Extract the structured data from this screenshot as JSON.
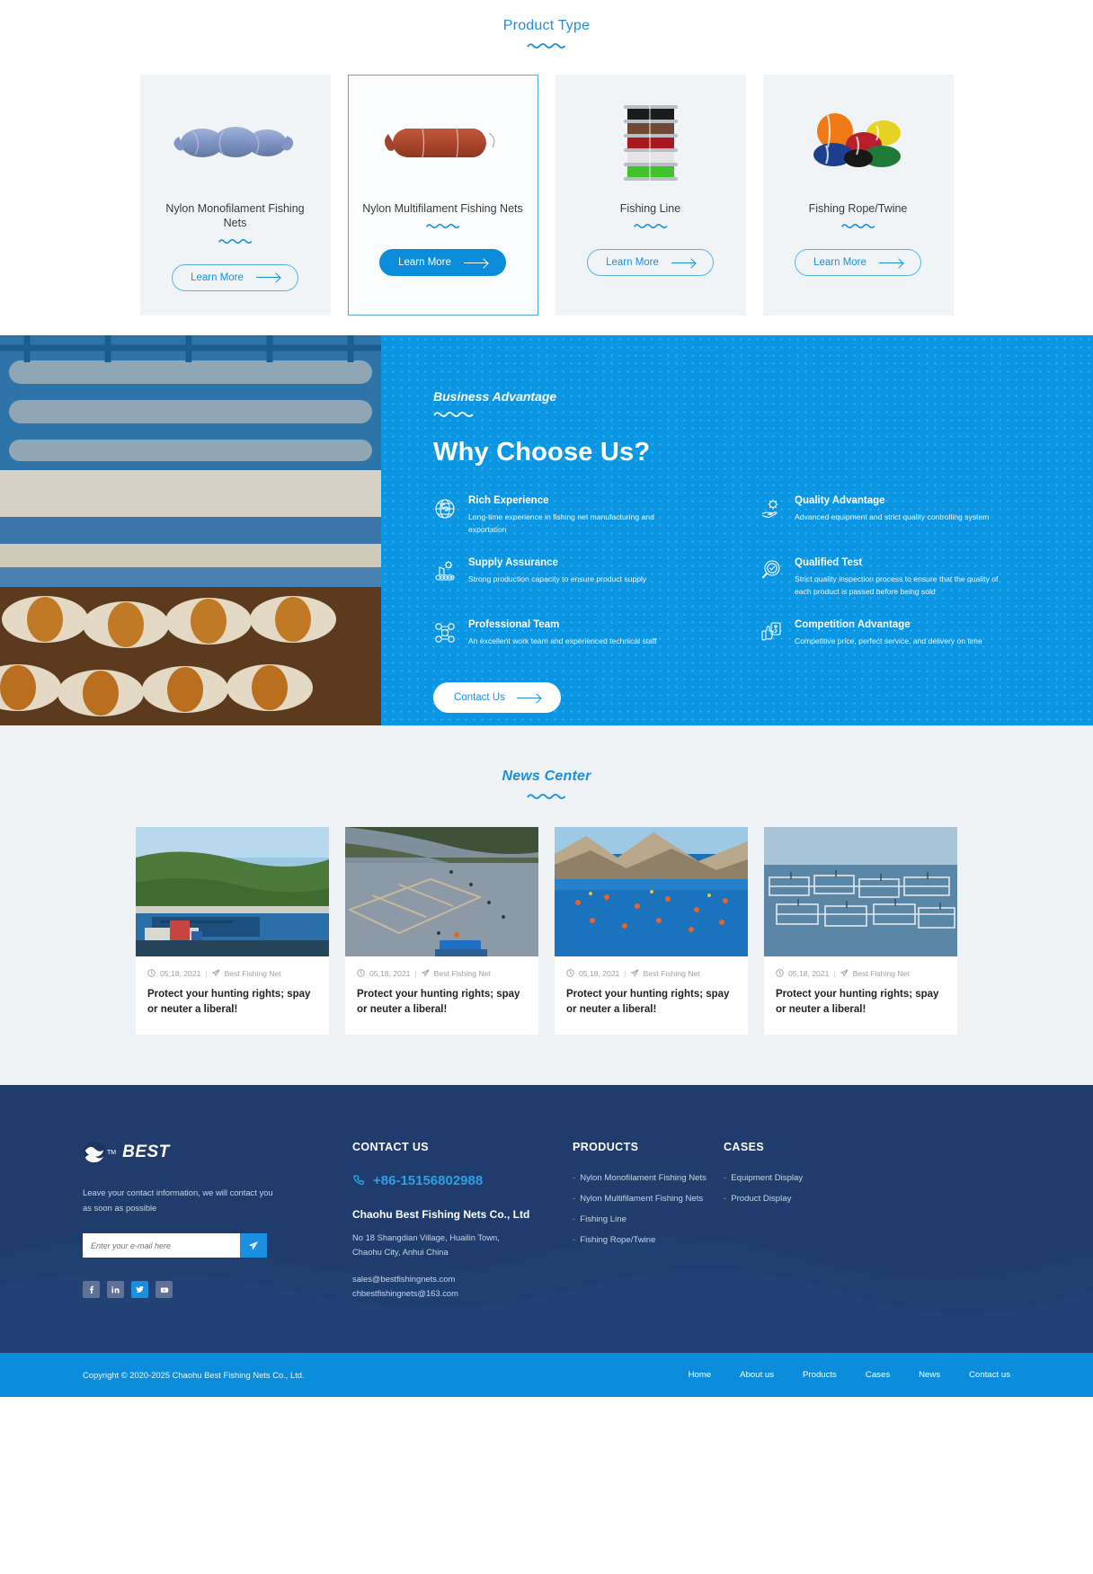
{
  "product_section": {
    "title": "Product Type",
    "cards": [
      {
        "name": "Nylon Monofilament Fishing Nets",
        "button": "Learn More",
        "image": "blue-mono-net-bundle",
        "active": false
      },
      {
        "name": "Nylon Multifilament Fishing Nets",
        "button": "Learn More",
        "image": "red-multi-net-bundle",
        "active": true
      },
      {
        "name": "Fishing Line",
        "button": "Learn More",
        "image": "stacked-line-spools",
        "active": false
      },
      {
        "name": "Fishing Rope/Twine",
        "button": "Learn More",
        "image": "colored-rope-coils",
        "active": false
      }
    ]
  },
  "advantage": {
    "eyebrow": "Business Advantage",
    "heading": "Why Choose Us?",
    "photo_alt": "net-weaving-machine-photo",
    "features": [
      {
        "icon": "globe-network-icon",
        "title": "Rich Experience",
        "desc": "Long-time experience in fishing net manufacturing and exportation"
      },
      {
        "icon": "hand-gear-icon",
        "title": "Quality Advantage",
        "desc": "Advanced equipment and strict quality controlling system"
      },
      {
        "icon": "factory-gear-icon",
        "title": "Supply Assurance",
        "desc": "Strong production capacity to ensure product supply"
      },
      {
        "icon": "magnifier-check-icon",
        "title": "Qualified Test",
        "desc": "Strict quality inspection process to ensure that the quality of each product is passed before being sold"
      },
      {
        "icon": "team-nodes-icon",
        "title": "Professional Team",
        "desc": "An excellent work team and experienced technical staff"
      },
      {
        "icon": "thumbs-up-price-icon",
        "title": "Competition Advantage",
        "desc": "Competitive price, perfect service, and delivery on time"
      }
    ],
    "contact_button": "Contact Us"
  },
  "news": {
    "title": "News Center",
    "items": [
      {
        "date": "05,18, 2021",
        "source": "Best Fishing Net",
        "title": "Protect your hunting rights; spay or neuter a liberal!",
        "image": "coastal-fish-farm-huts"
      },
      {
        "date": "05,18, 2021",
        "source": "Best Fishing Net",
        "title": "Protect your hunting rights; spay or neuter a liberal!",
        "image": "floating-net-pens-lake"
      },
      {
        "date": "05,18, 2021",
        "source": "Best Fishing Net",
        "title": "Protect your hunting rights; spay or neuter a liberal!",
        "image": "mountain-bay-buoys"
      },
      {
        "date": "05,18, 2021",
        "source": "Best Fishing Net",
        "title": "Protect your hunting rights; spay or neuter a liberal!",
        "image": "offshore-fish-cages"
      }
    ]
  },
  "footer": {
    "brand": {
      "logo_text": "BEST",
      "trademark": "TM"
    },
    "description": "Leave your contact information, we will contact you as soon as possible",
    "subscribe": {
      "placeholder": "Enter your e-mail here",
      "value": "",
      "send_icon": "paper-plane-icon"
    },
    "socials": [
      {
        "name": "facebook-icon",
        "glyph": "f"
      },
      {
        "name": "linkedin-icon",
        "glyph": "in"
      },
      {
        "name": "twitter-icon",
        "glyph": "t"
      },
      {
        "name": "youtube-icon",
        "glyph": "▶"
      }
    ],
    "contact": {
      "title": "CONTACT US",
      "phone": "+86-15156802988",
      "company": "Chaohu Best Fishing Nets Co., Ltd",
      "address_line1": "No 18 Shangdian Village, Huailin Town,",
      "address_line2": "Chaohu City, Anhui China",
      "email1": "sales@bestfishingnets.com",
      "email2": "chbestfishingnets@163.com"
    },
    "products": {
      "title": "PRODUCTS",
      "items": [
        "Nylon Monofilament Fishing Nets",
        "Nylon Multifilament Fishing Nets",
        "Fishing Line",
        "Fishing Rope/Twine"
      ]
    },
    "cases": {
      "title": "CASES",
      "items": [
        "Equipment Display",
        "Product Display"
      ]
    },
    "copyright": "Copyright © 2020-2025 Chaohu Best Fishing Nets Co., Ltd.",
    "nav": [
      "Home",
      "About us",
      "Products",
      "Cases",
      "News",
      "Contact us"
    ]
  },
  "colors": {
    "accent": "#0b8ddc",
    "accent_light": "#1a8fe0",
    "band": "#0b96e4",
    "footer_bg": "#1f3c6d",
    "news_bg": "#eef2f5",
    "card_bg": "#f1f4f6"
  }
}
